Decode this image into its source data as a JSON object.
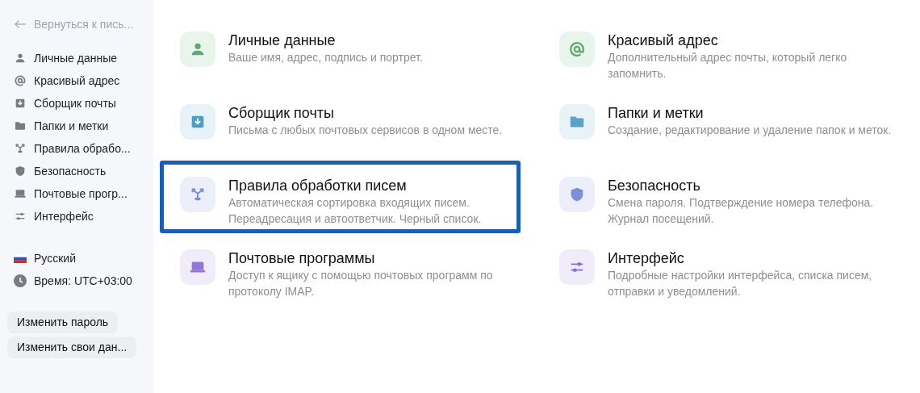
{
  "sidebar": {
    "back_link": "Вернуться к пись...",
    "items": [
      {
        "label": "Личные данные"
      },
      {
        "label": "Красивый адрес"
      },
      {
        "label": "Сборщик почты"
      },
      {
        "label": "Папки и метки"
      },
      {
        "label": "Правила обрабо..."
      },
      {
        "label": "Безопасность"
      },
      {
        "label": "Почтовые прогр..."
      },
      {
        "label": "Интерфейс"
      }
    ],
    "language": "Русский",
    "timezone": "Время: UTC+03:00",
    "buttons": [
      "Изменить пароль",
      "Изменить свои дан..."
    ]
  },
  "cards": [
    {
      "title": "Личные данные",
      "description": "Ваше имя, адрес, подпись и портрет.",
      "highlighted": false
    },
    {
      "title": "Красивый адрес",
      "description": "Дополнительный адрес почты, который легко запомнить.",
      "highlighted": false
    },
    {
      "title": "Сборщик почты",
      "description": "Письма с любых почтовых сервисов в одном месте.",
      "highlighted": false
    },
    {
      "title": "Папки и метки",
      "description": "Создание, редактирование и удаление папок и меток.",
      "highlighted": false
    },
    {
      "title": "Правила обработки писем",
      "description": "Автоматическая сортировка входящих писем. Переадресация и автоответчик. Черный список.",
      "highlighted": true
    },
    {
      "title": "Безопасность",
      "description": "Смена пароля. Подтверждение номера телефона. Журнал посещений.",
      "highlighted": false
    },
    {
      "title": "Почтовые программы",
      "description": "Доступ к ящику с помощью почтовых программ по протоколу IMAP.",
      "highlighted": false
    },
    {
      "title": "Интерфейс",
      "description": "Подробные настройки интерфейса, списка писем, отправки и уведомлений.",
      "highlighted": false
    }
  ]
}
